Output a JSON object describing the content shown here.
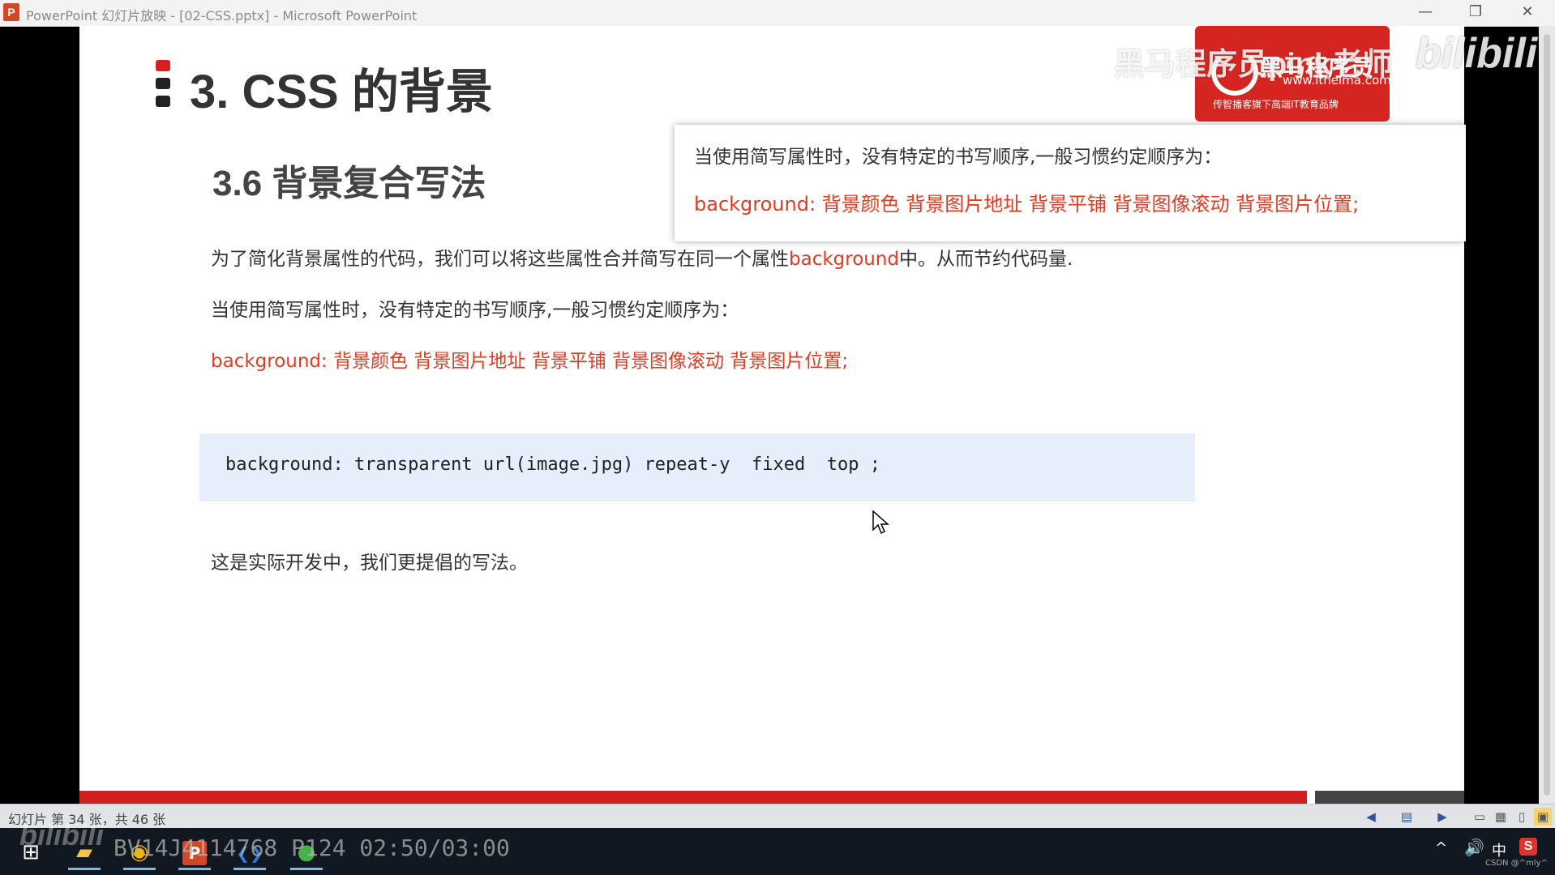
{
  "window": {
    "app_icon": "P",
    "title": "PowerPoint 幻灯片放映 - [02-CSS.pptx] - Microsoft PowerPoint",
    "minimize_icon": "—",
    "restore_icon": "❐",
    "close_icon": "✕"
  },
  "slide": {
    "title": "3. CSS 的背景",
    "section_title": "3.6 背景复合写法",
    "para1_prefix": "为了简化背景属性的代码，我们可以将这些属性合并简写在同一个属性",
    "para1_highlight": "background",
    "para1_suffix": "中。从而节约代码量.",
    "para2": "当使用简写属性时，没有特定的书写顺序,一般习惯约定顺序为：",
    "para3": "background: 背景颜色 背景图片地址 背景平铺 背景图像滚动 背景图片位置;",
    "code": "background: transparent url(image.jpg) repeat-y  fixed  top ;",
    "para4": "这是实际开发中，我们更提倡的写法。"
  },
  "popup": {
    "line1": "当使用简写属性时，没有特定的书写顺序,一般习惯约定顺序为：",
    "line2": "background: 背景颜色 背景图片地址 背景平铺 背景图像滚动 背景图片位置;"
  },
  "logo": {
    "main": "黑马程序员",
    "url": "www.itheima.com",
    "slogan": "传智播客旗下高端IT教育品牌"
  },
  "watermarks": {
    "teacher": "黑马程序员pink老师",
    "bilibili": "bilibili"
  },
  "statusbar": {
    "slide_count": "幻灯片 第 34 张，共 46 张",
    "prev_icon": "◀",
    "notes_icon": "▤",
    "next_icon": "▶",
    "normal_view_icon": "▭",
    "sorter_view_icon": "▦",
    "reading_view_icon": "▯",
    "slideshow_view_icon": "▣"
  },
  "taskbar": {
    "start_icon": "⊞",
    "explorer_icon": "▰",
    "chrome_icon": "◉",
    "ppt_icon": "P",
    "vscode_icon": "❮❯",
    "green_icon": "●",
    "video_id": "BV14J4114768 P124 02:50/03:00",
    "tray_chevron": "^",
    "tray_volume": "🔊",
    "tray_ime": "中",
    "tray_s": "S",
    "csdn": "CSDN @^mly^"
  },
  "colors": {
    "accent_red": "#e43a22",
    "code_bg": "#e6eefc",
    "bottom_bar": "#d21f1f"
  }
}
